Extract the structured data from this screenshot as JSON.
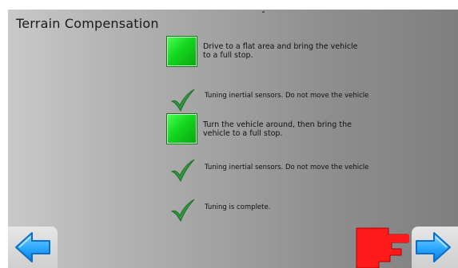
{
  "screen": {
    "title": "Terrain Compensation"
  },
  "steps": [
    {
      "state": "pending",
      "icon": "green-square",
      "lines": [
        "Drive to a flat area and bring the vehicle",
        "to a full stop."
      ]
    },
    {
      "state": "done",
      "icon": "checkmark",
      "lines": [
        "Tuning inertial sensors. Do not move the vehicle"
      ]
    },
    {
      "state": "pending",
      "icon": "green-square",
      "lines": [
        "Turn the vehicle around, then bring the",
        "vehicle to a full stop."
      ]
    },
    {
      "state": "done",
      "icon": "checkmark",
      "lines": [
        "Tuning inertial sensors. Do not move the vehicle"
      ]
    },
    {
      "state": "done",
      "icon": "checkmark",
      "lines": [
        "Tuning is complete."
      ]
    }
  ],
  "navigation": {
    "back_icon": "arrow-left-icon",
    "next_icon": "arrow-right-icon",
    "pointer_icon": "red-hand-pointer-icon"
  },
  "colors": {
    "accent_green": "#14d61f",
    "check_green": "#2f9a3a",
    "arrow_blue": "#2aa7ff",
    "pointer_red": "#ff1a1a"
  }
}
